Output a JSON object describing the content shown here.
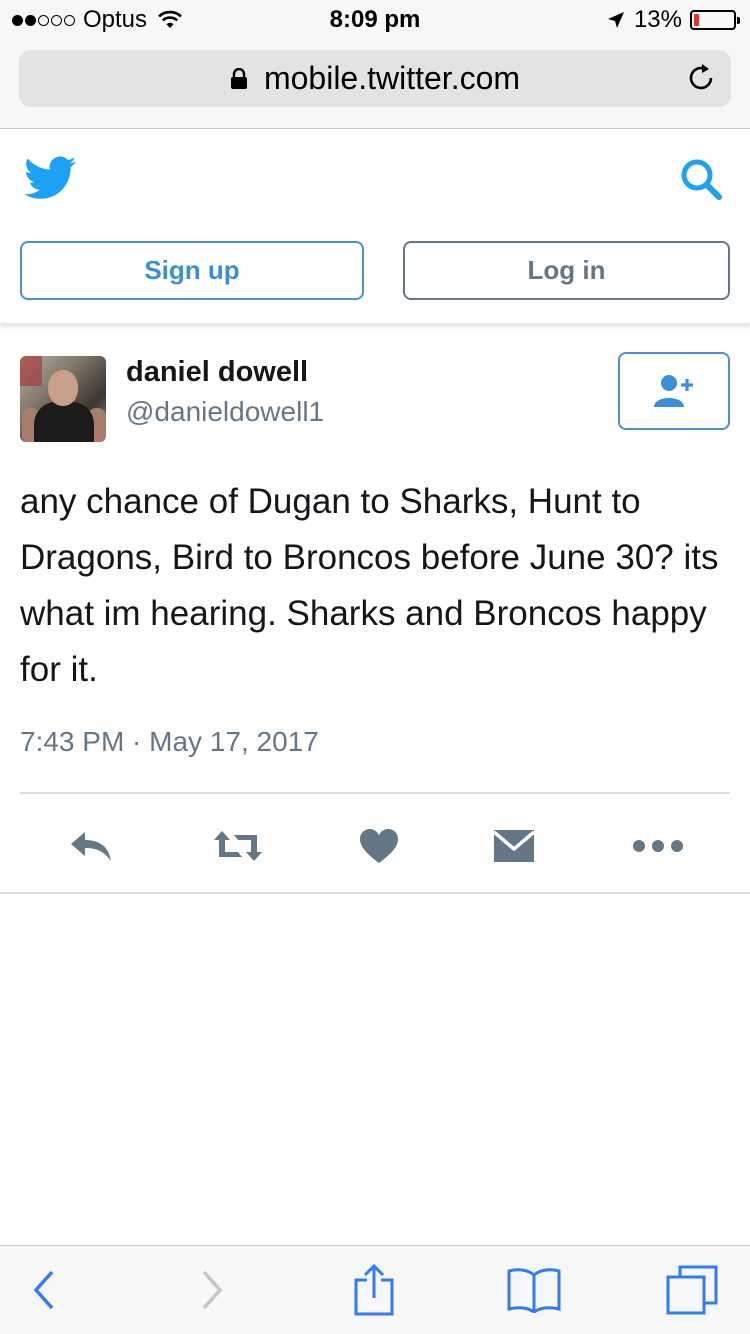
{
  "status_bar": {
    "carrier": "Optus",
    "time": "8:09 pm",
    "battery_percent": "13%",
    "battery_level": 0.13,
    "signal_bars_filled": 2,
    "signal_bars_total": 5
  },
  "browser": {
    "url": "mobile.twitter.com"
  },
  "header": {
    "signup_label": "Sign up",
    "login_label": "Log in",
    "brand_color": "#1da1f2"
  },
  "tweet": {
    "display_name": "daniel dowell",
    "handle": "@danieldowell1",
    "text": "any chance of Dugan to Sharks, Hunt to Dragons, Bird to Broncos before June 30? its what im hearing. Sharks and Broncos happy for it.",
    "timestamp": "7:43 PM · May 17, 2017"
  },
  "actions": [
    "reply-icon",
    "retweet-icon",
    "like-icon",
    "direct-message-icon",
    "more-icon"
  ],
  "toolbar": [
    "back-icon",
    "forward-icon",
    "share-icon",
    "bookmarks-icon",
    "tabs-icon"
  ]
}
